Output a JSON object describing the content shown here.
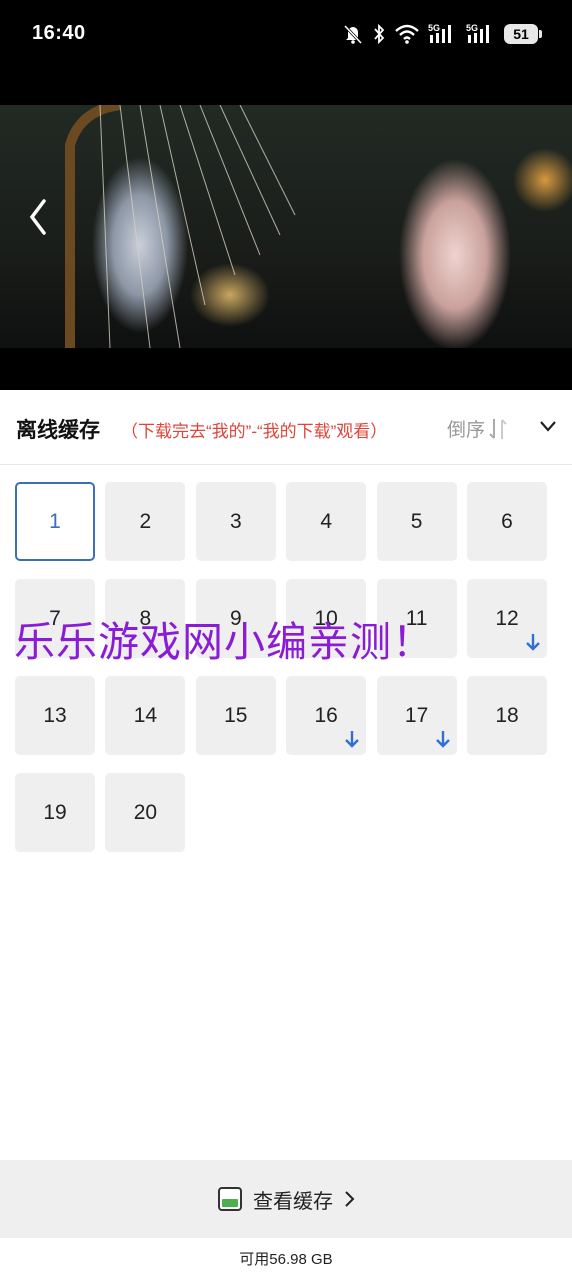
{
  "status": {
    "time": "16:40",
    "battery": "51",
    "signal1": "5G",
    "signal2": "5G"
  },
  "header": {
    "title": "离线缓存",
    "hint": "（下载完去“我的”-“我的下载”观看）",
    "order_label": "倒序"
  },
  "episodes": [
    {
      "num": "1",
      "active": true,
      "downloading": false
    },
    {
      "num": "2",
      "active": false,
      "downloading": false
    },
    {
      "num": "3",
      "active": false,
      "downloading": false
    },
    {
      "num": "4",
      "active": false,
      "downloading": false
    },
    {
      "num": "5",
      "active": false,
      "downloading": false
    },
    {
      "num": "6",
      "active": false,
      "downloading": false
    },
    {
      "num": "7",
      "active": false,
      "downloading": false
    },
    {
      "num": "8",
      "active": false,
      "downloading": false
    },
    {
      "num": "9",
      "active": false,
      "downloading": false
    },
    {
      "num": "10",
      "active": false,
      "downloading": false
    },
    {
      "num": "11",
      "active": false,
      "downloading": false
    },
    {
      "num": "12",
      "active": false,
      "downloading": true
    },
    {
      "num": "13",
      "active": false,
      "downloading": false
    },
    {
      "num": "14",
      "active": false,
      "downloading": false
    },
    {
      "num": "15",
      "active": false,
      "downloading": false
    },
    {
      "num": "16",
      "active": false,
      "downloading": true
    },
    {
      "num": "17",
      "active": false,
      "downloading": true
    },
    {
      "num": "18",
      "active": false,
      "downloading": false
    },
    {
      "num": "19",
      "active": false,
      "downloading": false
    },
    {
      "num": "20",
      "active": false,
      "downloading": false
    }
  ],
  "watermark": "乐乐游戏网小编亲测！",
  "footer": {
    "view_cache_label": "查看缓存",
    "available": "可用56.98 GB"
  },
  "colors": {
    "accent": "#3d6fb6",
    "hint": "#e0443a",
    "download_arrow": "#2f6fd6",
    "watermark": "#8a1cd6"
  }
}
